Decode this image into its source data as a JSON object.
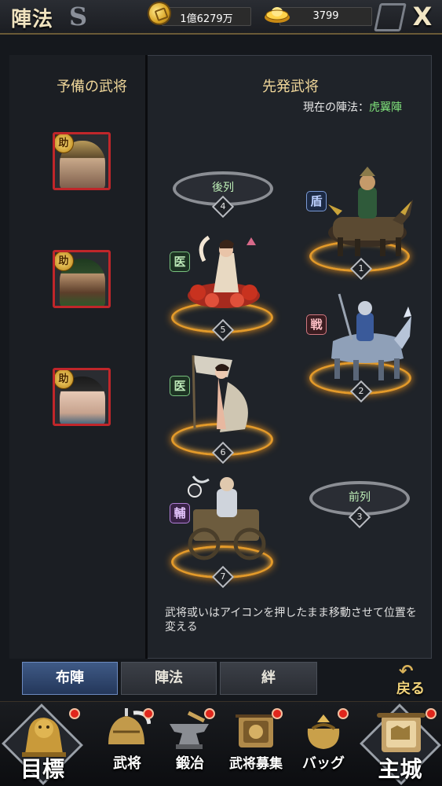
{
  "header": {
    "title": "陣法",
    "close_label": "X",
    "currencies": [
      {
        "icon": "coin-icon",
        "value": "1億6279万"
      },
      {
        "icon": "gold-ingot-icon",
        "value": "3799"
      }
    ]
  },
  "reserve": {
    "title": "予備の武将",
    "badge": "助",
    "generals": [
      {
        "portrait": "general-portrait-helmet"
      },
      {
        "portrait": "general-portrait-bearded"
      },
      {
        "portrait": "general-portrait-hat"
      }
    ]
  },
  "formation": {
    "title": "先発武将",
    "status_label": "現在の陣法：",
    "status_value": "虎翼陣",
    "rear_label": "後列",
    "front_label": "前列",
    "slots": [
      {
        "num": "1",
        "role": "盾"
      },
      {
        "num": "2",
        "role": "戦"
      },
      {
        "num": "3"
      },
      {
        "num": "4"
      },
      {
        "num": "5",
        "role": "医"
      },
      {
        "num": "6",
        "role": "医"
      },
      {
        "num": "7",
        "role": "輔"
      }
    ],
    "hint": "武将或いはアイコンを押したまま移動させて位置を変える"
  },
  "tabs": [
    {
      "label": "布陣",
      "active": true
    },
    {
      "label": "陣法",
      "active": false
    },
    {
      "label": "絆",
      "active": false
    }
  ],
  "back_label": "戻る",
  "nav": [
    {
      "label": "目標",
      "icon": "lion-statue-icon",
      "dot": true
    },
    {
      "label": "武将",
      "icon": "helmet-icon",
      "dot": true
    },
    {
      "label": "鍛冶",
      "icon": "anvil-icon",
      "dot": true
    },
    {
      "label": "武将募集",
      "icon": "recruit-scroll-icon",
      "dot": true
    },
    {
      "label": "バッグ",
      "icon": "bag-icon",
      "dot": true
    },
    {
      "label": "主城",
      "icon": "castle-scroll-icon",
      "dot": true
    }
  ],
  "colors": {
    "accent_gold": "#e39a2a",
    "active_tab": "#3f5a86",
    "badge_red": "#c0262a",
    "formation_value": "#7fe07a"
  }
}
